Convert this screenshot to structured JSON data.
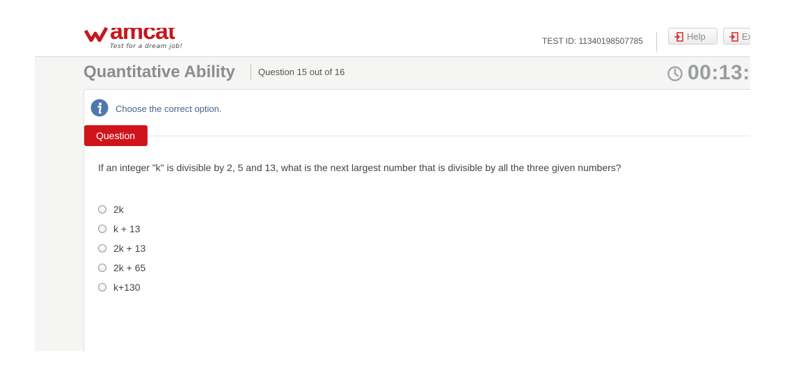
{
  "header": {
    "logo_text": "amcat",
    "tagline": "Test for a dream job!",
    "test_id": "TEST ID: 11340198507785",
    "help_label": "Help",
    "exit_label": "Ex",
    "brand_color": "#c8161d"
  },
  "section": {
    "title": "Quantitative Ability",
    "progress": "Question 15 out of 16",
    "timer": "00:13:"
  },
  "panel": {
    "instruction": "Choose the correct option.",
    "tab_label": "Question",
    "tab_color": "#d0141b",
    "question_text": "If an integer \"k\" is divisible by 2, 5 and 13, what is the next largest number that is divisible by all the three given numbers?",
    "options": [
      "2k",
      "k + 13",
      "2k + 13",
      "2k + 65",
      "k+130"
    ]
  },
  "icons": {
    "info": "info-icon",
    "clock": "clock-icon",
    "help": "help-door-icon",
    "exit": "exit-door-icon",
    "radio": "radio-button"
  }
}
